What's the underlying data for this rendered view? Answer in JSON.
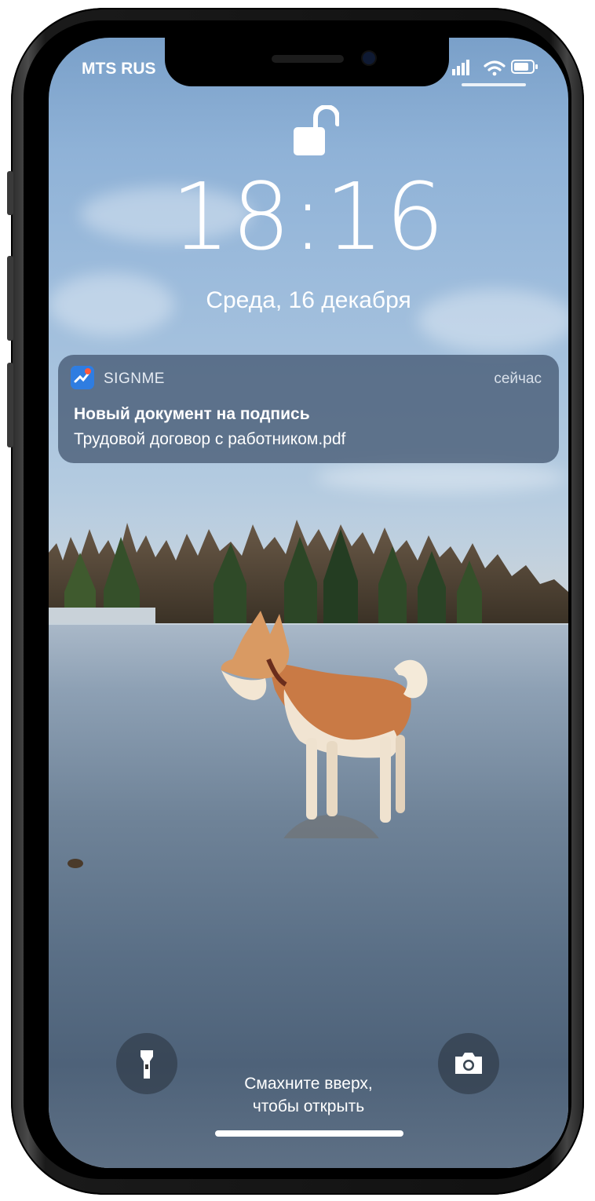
{
  "status_bar": {
    "carrier": "MTS RUS",
    "icons": [
      "signal-icon",
      "wifi-icon",
      "battery-icon"
    ]
  },
  "lock_screen": {
    "lock_state_icon": "unlocked-padlock-icon",
    "time": "18:16",
    "date": "Среда, 16 декабря"
  },
  "notification": {
    "app_icon": "signme-app-icon",
    "app_name": "SIGNME",
    "time": "сейчас",
    "title": "Новый документ на подпись",
    "body": "Трудовой договор с работником.pdf"
  },
  "quick_actions": {
    "left_icon": "flashlight-icon",
    "right_icon": "camera-icon"
  },
  "hint": {
    "line1": "Смахните вверх,",
    "line2": "чтобы открыть"
  },
  "colors": {
    "sky": "#8fb2d7",
    "ice": "#6f8398",
    "notification_bg": "#465a73",
    "text": "#ffffff"
  }
}
